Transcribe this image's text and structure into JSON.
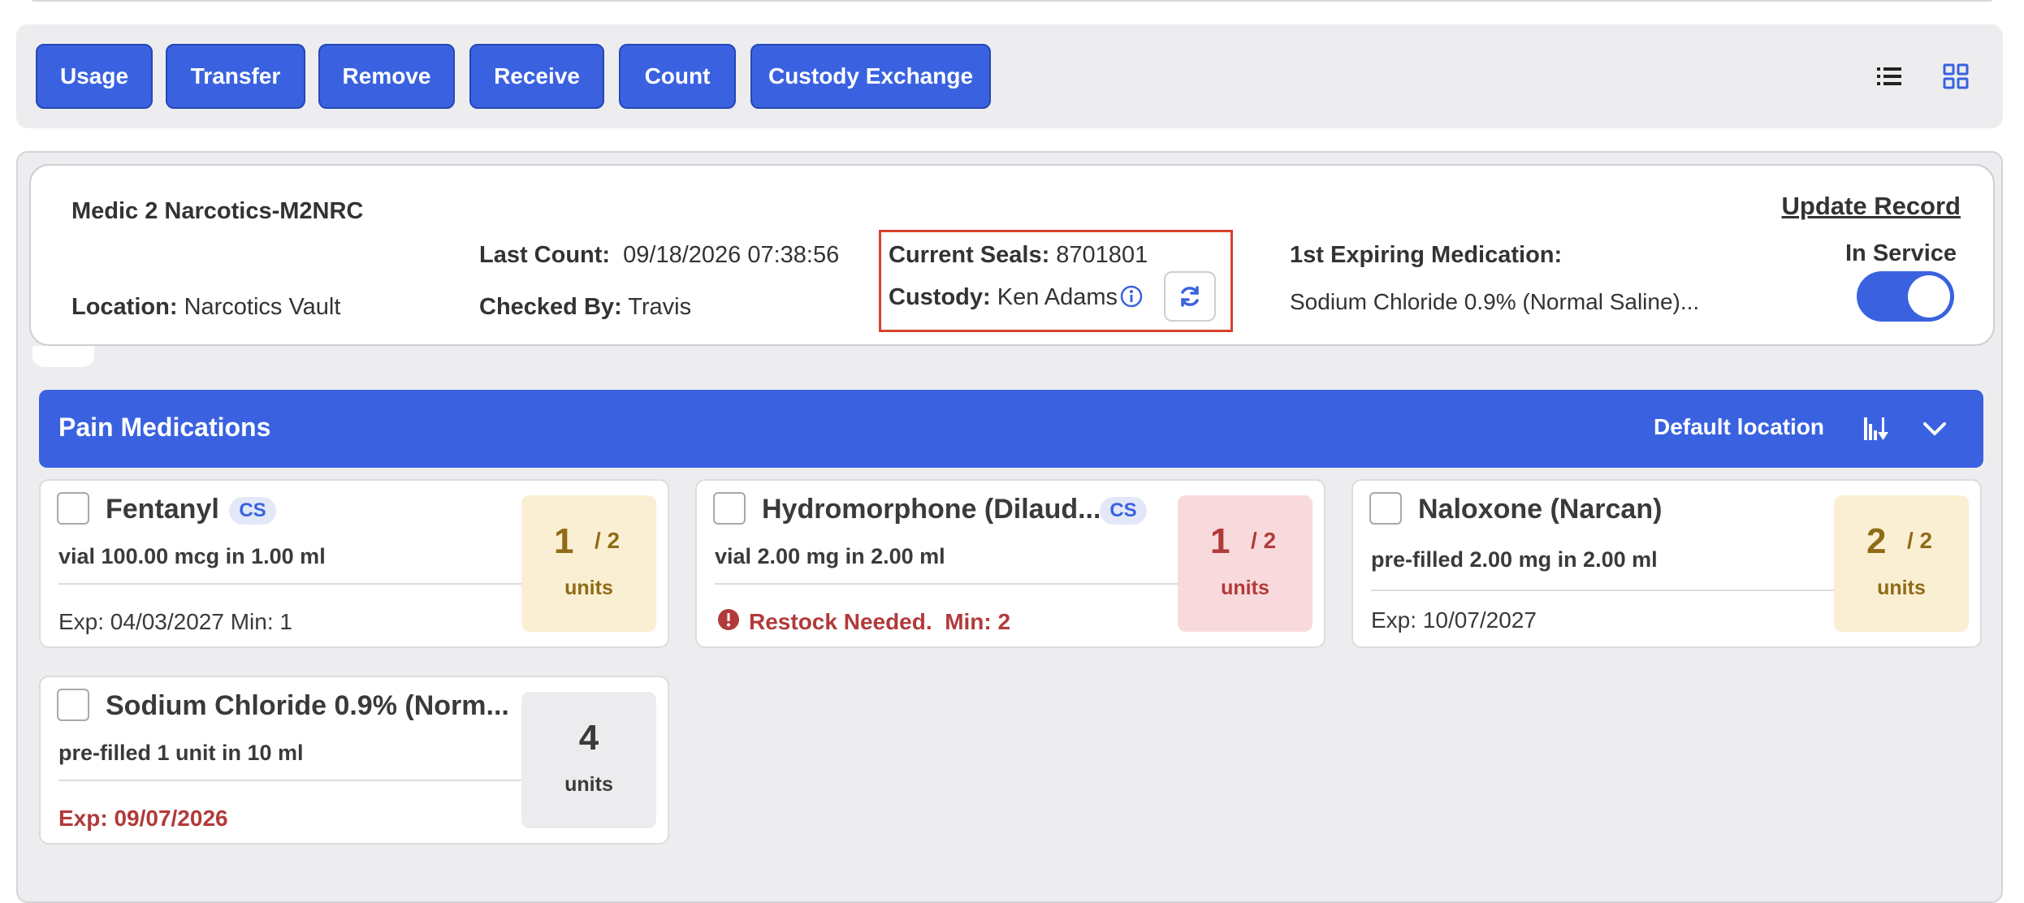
{
  "toolbar": {
    "buttons": [
      {
        "label": "Usage"
      },
      {
        "label": "Transfer"
      },
      {
        "label": "Remove"
      },
      {
        "label": "Receive"
      },
      {
        "label": "Count"
      },
      {
        "label": "Custody Exchange"
      }
    ],
    "view_icons": [
      "list-view-icon",
      "grid-view-icon"
    ]
  },
  "record": {
    "title": "Medic 2 Narcotics-M2NRC",
    "location_label": "Location:",
    "location_value": "Narcotics Vault",
    "last_count_label": "Last Count:",
    "last_count_value": "09/18/2026 07:38:56",
    "checked_by_label": "Checked By:",
    "checked_by_value": "Travis",
    "seals_label": "Current Seals:",
    "seals_value": "8701801",
    "custody_label": "Custody:",
    "custody_value": "Ken Adams",
    "expiring_label": "1st Expiring Medication:",
    "expiring_value": "Sodium Chloride 0.9% (Normal Saline)...",
    "update_link": "Update Record",
    "status_label": "In Service",
    "in_service": true
  },
  "section": {
    "title": "Pain Medications",
    "location": "Default location"
  },
  "colors": {
    "primary": "#3a62e0",
    "alert_red": "#b23a3a",
    "highlight_border": "#d8412f",
    "yellow_bg": "#fbefd3",
    "red_bg": "#f9dadc",
    "gray_bg": "#ececee"
  },
  "medications": [
    {
      "name": "Fentanyl",
      "cs": "CS",
      "desc": "vial 100.00 mcg in 1.00 ml",
      "footer": "Exp: 04/03/2027 Min: 1",
      "qty": "1",
      "max": "/ 2",
      "unit": "units"
    },
    {
      "name": "Hydromorphone (Dilaud...",
      "cs": "CS",
      "desc": "vial 2.00 mg in 2.00 ml",
      "footer": "Restock Needed.  Min: 2",
      "qty": "1",
      "max": "/ 2",
      "unit": "units"
    },
    {
      "name": "Naloxone (Narcan)",
      "desc": "pre-filled 2.00 mg in 2.00 ml",
      "footer": "Exp: 10/07/2027",
      "qty": "2",
      "max": "/ 2",
      "unit": "units"
    },
    {
      "name": "Sodium Chloride 0.9% (Norm...",
      "desc": "pre-filled 1 unit in 10 ml",
      "footer": "Exp: 09/07/2026",
      "qty": "4",
      "unit": "units"
    }
  ]
}
